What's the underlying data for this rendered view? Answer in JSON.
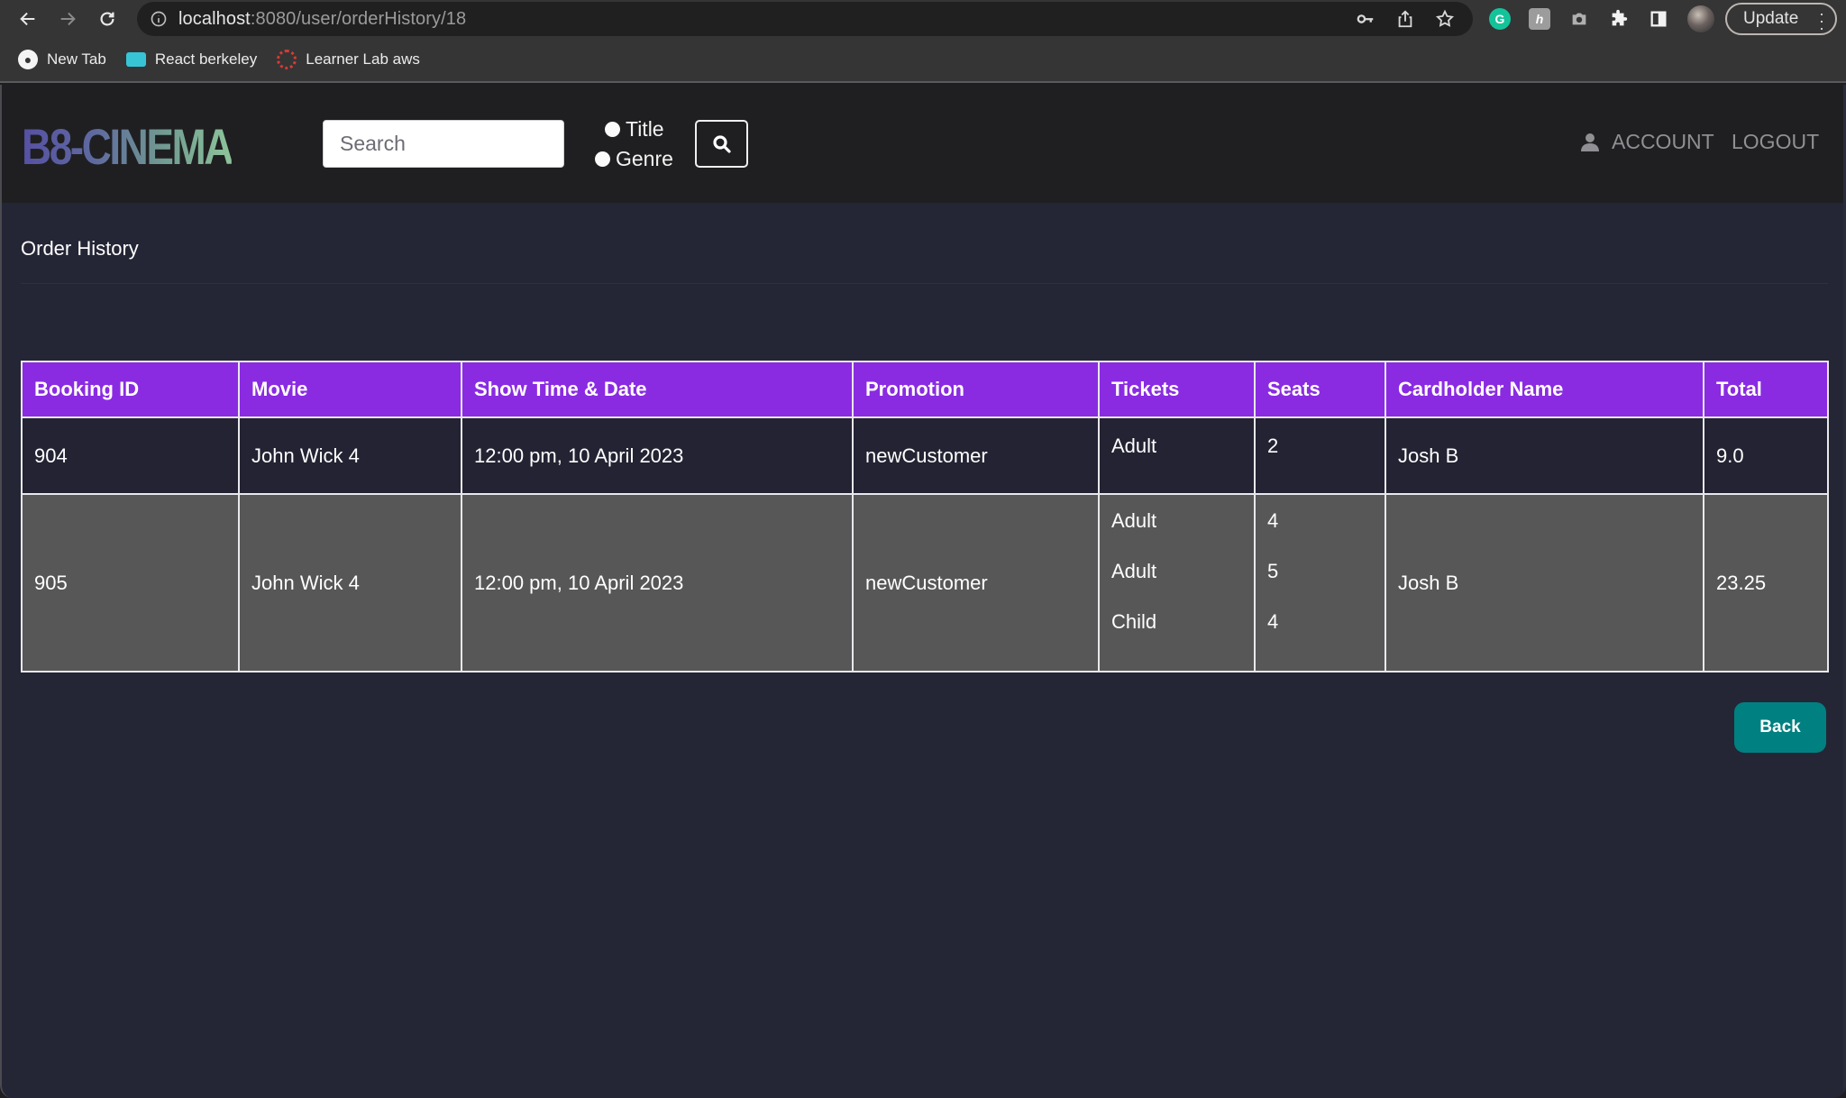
{
  "browser": {
    "url_host": "localhost",
    "url_rest": ":8080/user/orderHistory/18",
    "update_label": "Update",
    "bookmarks": [
      {
        "label": "New Tab",
        "icon": "globe-icon"
      },
      {
        "label": "React berkeley",
        "icon": "monitor-icon"
      },
      {
        "label": "Learner Lab aws",
        "icon": "canvas-icon"
      }
    ],
    "extensions": [
      "grammarly-icon",
      "honey-icon",
      "camera-icon",
      "puzzle-icon",
      "side-panel-icon",
      "profile-avatar"
    ]
  },
  "header": {
    "logo": "B8-CINEMA",
    "search_placeholder": "Search",
    "search_value": "",
    "radio_title": "Title",
    "radio_genre": "Genre",
    "account_label": "ACCOUNT",
    "logout_label": "LOGOUT"
  },
  "main": {
    "title": "Order History",
    "columns": [
      "Booking ID",
      "Movie",
      "Show Time & Date",
      "Promotion",
      "Tickets",
      "Seats",
      "Cardholder Name",
      "Total"
    ],
    "rows": [
      {
        "booking_id": "904",
        "movie": "John Wick 4",
        "show_time": "12:00 pm, 10 April 2023",
        "promotion": "newCustomer",
        "tickets": [
          "Adult"
        ],
        "seats": [
          "2"
        ],
        "cardholder": "Josh B",
        "total": "9.0"
      },
      {
        "booking_id": "905",
        "movie": "John Wick 4",
        "show_time": "12:00 pm, 10 April 2023",
        "promotion": "newCustomer",
        "tickets": [
          "Adult",
          "Adult",
          "Child"
        ],
        "seats": [
          "4",
          "5",
          "4"
        ],
        "cardholder": "Josh B",
        "total": "23.25"
      }
    ],
    "back_label": "Back"
  },
  "colors": {
    "header_purple": "#8a2be2",
    "back_teal": "#008080",
    "page_bg": "#242535",
    "alt_row": "#575757"
  }
}
